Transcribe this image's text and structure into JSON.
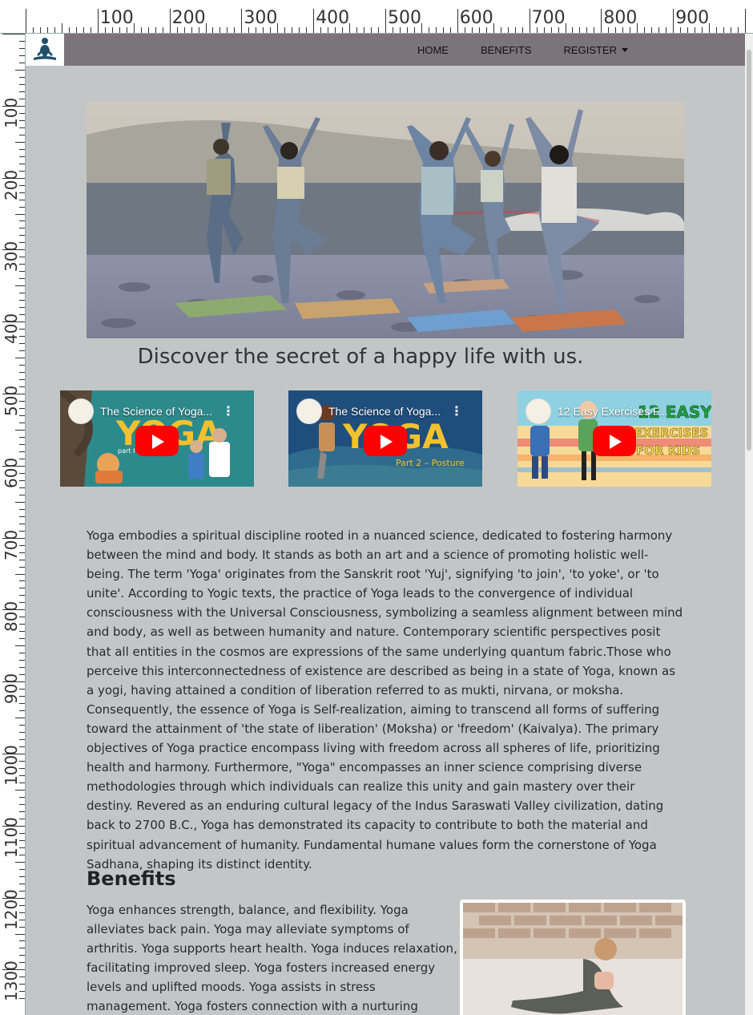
{
  "ruler": {
    "top_labels": [
      "100",
      "200",
      "300",
      "400",
      "500",
      "600",
      "700",
      "800",
      "900"
    ],
    "left_labels": [
      "100",
      "200",
      "300",
      "400",
      "500",
      "600",
      "700",
      "800",
      "900",
      "1000",
      "1100",
      "1200",
      "1300"
    ]
  },
  "nav": {
    "logo_icon": "yoga-meditation-icon",
    "items": [
      {
        "label": "HOME"
      },
      {
        "label": "BENEFITS"
      },
      {
        "label": "REGISTER"
      }
    ]
  },
  "hero": {
    "tagline": "Discover the secret of a happy life with us."
  },
  "videos": [
    {
      "title": "The Science of Yoga...",
      "art_text": "YOGA",
      "sub": "part I"
    },
    {
      "title": "The Science of Yoga...",
      "art_text": "YOGA",
      "sub": "Part 2 – Posture"
    },
    {
      "title": "12 Easy Exercises F...",
      "art_text": "12 EASY EXERCISES FOR KIDS",
      "sub": ""
    }
  ],
  "about": {
    "text": "Yoga embodies a spiritual discipline rooted in a nuanced science, dedicated to fostering harmony between the mind and body. It stands as both an art and a science of promoting holistic well-being. The term 'Yoga' originates from the Sanskrit root 'Yuj', signifying 'to join', 'to yoke', or 'to unite'. According to Yogic texts, the practice of Yoga leads to the convergence of individual consciousness with the Universal Consciousness, symbolizing a seamless alignment between mind and body, as well as between humanity and nature. Contemporary scientific perspectives posit that all entities in the cosmos are expressions of the same underlying quantum fabric.Those who perceive this interconnectedness of existence are described as being in a state of Yoga, known as a yogi, having attained a condition of liberation referred to as mukti, nirvana, or moksha. Consequently, the essence of Yoga is Self-realization, aiming to transcend all forms of suffering toward the attainment of 'the state of liberation' (Moksha) or 'freedom' (Kaivalya). The primary objectives of Yoga practice encompass living with freedom across all spheres of life, prioritizing health and harmony. Furthermore, \"Yoga\" encompasses an inner science comprising diverse methodologies through which individuals can realize this unity and gain mastery over their destiny. Revered as an enduring cultural legacy of the Indus Saraswati Valley civilization, dating back to 2700 B.C., Yoga has demonstrated its capacity to contribute to both the material and spiritual advancement of humanity. Fundamental humane values form the cornerstone of Yoga Sadhana, shaping its distinct identity."
  },
  "benefits": {
    "title": "Benefits",
    "text": "Yoga enhances strength, balance, and flexibility. Yoga alleviates back pain. Yoga may alleviate symptoms of arthritis. Yoga supports heart health. Yoga induces relaxation, facilitating improved sleep. Yoga fosters increased energy levels and uplifted moods. Yoga assists in stress management. Yoga fosters connection with a nurturing community. Yoga encourages"
  },
  "colors": {
    "navbar": "#7d7479",
    "page_bg": "#c3c6c6",
    "youtube_red": "#ff0000"
  }
}
